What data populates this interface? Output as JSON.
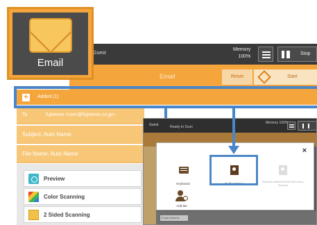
{
  "topbar": {
    "user_text": "Guest",
    "memory_label": "Memory",
    "memory_value": "100%",
    "stop_label": "Stop"
  },
  "action_bar": {
    "title": "Email",
    "reset_label": "Reset",
    "start_label": "Start"
  },
  "recipients": {
    "added_label": "Added (1)",
    "to_label": "To",
    "to_value": "fujixerox <user@fujixerox.co.jp>",
    "subject_text": "Subject: Auto Name",
    "file_name_text": "File Name: Auto Name"
  },
  "features": [
    {
      "label": "Preview",
      "icon": "preview-icon"
    },
    {
      "label": "Color Scanning",
      "icon": "color-scanning-icon"
    },
    {
      "label": "2 Sided Scanning",
      "icon": "two-sided-scanning-icon"
    }
  ],
  "popup": {
    "user_text": "Guest",
    "user_sub": "Ready to Scan",
    "memory_text": "Memory 100%",
    "dialog": {
      "close_label": "×",
      "keyboard_label": "Keyboard",
      "public_entries_label": "Public Entries",
      "mobile_label": "Network Address Book (Directory Service)",
      "add_me_label": "Add Me"
    },
    "bottom_item": "Email Address"
  },
  "callout": {
    "label": "Email"
  },
  "colors": {
    "orange": "#f4a53b",
    "highlight_blue": "#4a86c8",
    "dark_bar": "#3a3a3a"
  }
}
